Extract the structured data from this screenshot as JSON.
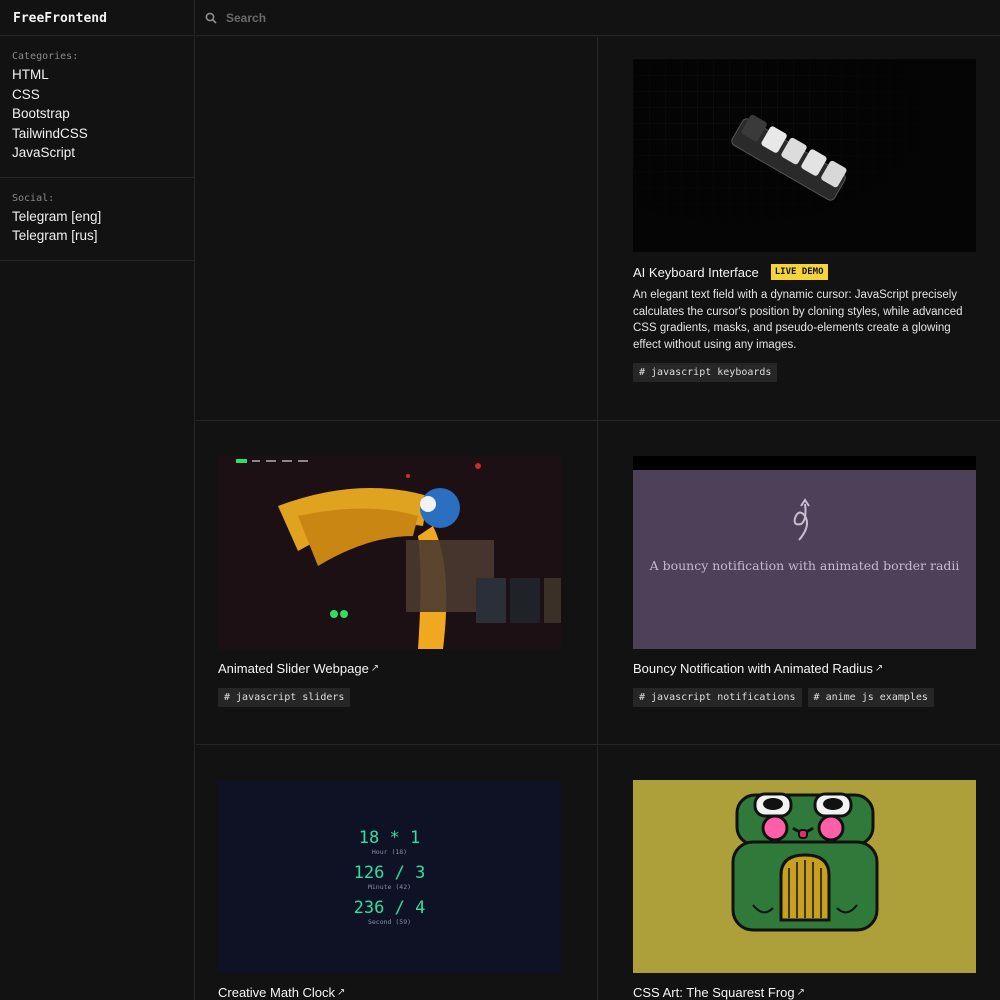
{
  "brand": "FreeFrontend",
  "sidebar": {
    "categories_label": "Categories:",
    "categories": [
      "HTML",
      "CSS",
      "Bootstrap",
      "TailwindCSS",
      "JavaScript"
    ],
    "social_label": "Social:",
    "social": [
      "Telegram [eng]",
      "Telegram [rus]"
    ]
  },
  "search": {
    "placeholder": "Search"
  },
  "cards": {
    "keyboard": {
      "title": "AI Keyboard Interface",
      "badge": "LIVE DEMO",
      "description": "An elegant text field with a dynamic cursor: JavaScript precisely calculates the cursor's position by cloning styles, while advanced CSS gradients, masks, and pseudo-elements create a glowing effect without using any images.",
      "tags": [
        "# javascript keyboards"
      ]
    },
    "slider": {
      "title": "Animated Slider Webpage",
      "tags": [
        "# javascript sliders"
      ]
    },
    "bouncy": {
      "title": "Bouncy Notification with Animated Radius",
      "preview_text": "A bouncy notification with animated border radii",
      "tags": [
        "# javascript notifications",
        "# anime js examples"
      ]
    },
    "clock": {
      "title": "Creative Math Clock",
      "rows": [
        {
          "expr": "18 * 1",
          "label": "Hour (18)"
        },
        {
          "expr": "126 / 3",
          "label": "Minute (42)"
        },
        {
          "expr": "236 / 4",
          "label": "Second (59)"
        }
      ]
    },
    "frog": {
      "title": "CSS Art: The Squarest Frog"
    }
  },
  "colors": {
    "accent": "#f5d33a",
    "clock_green": "#2fe0a0",
    "bouncy_bg": "#4d4159",
    "frog_bg": "#ada03a"
  }
}
